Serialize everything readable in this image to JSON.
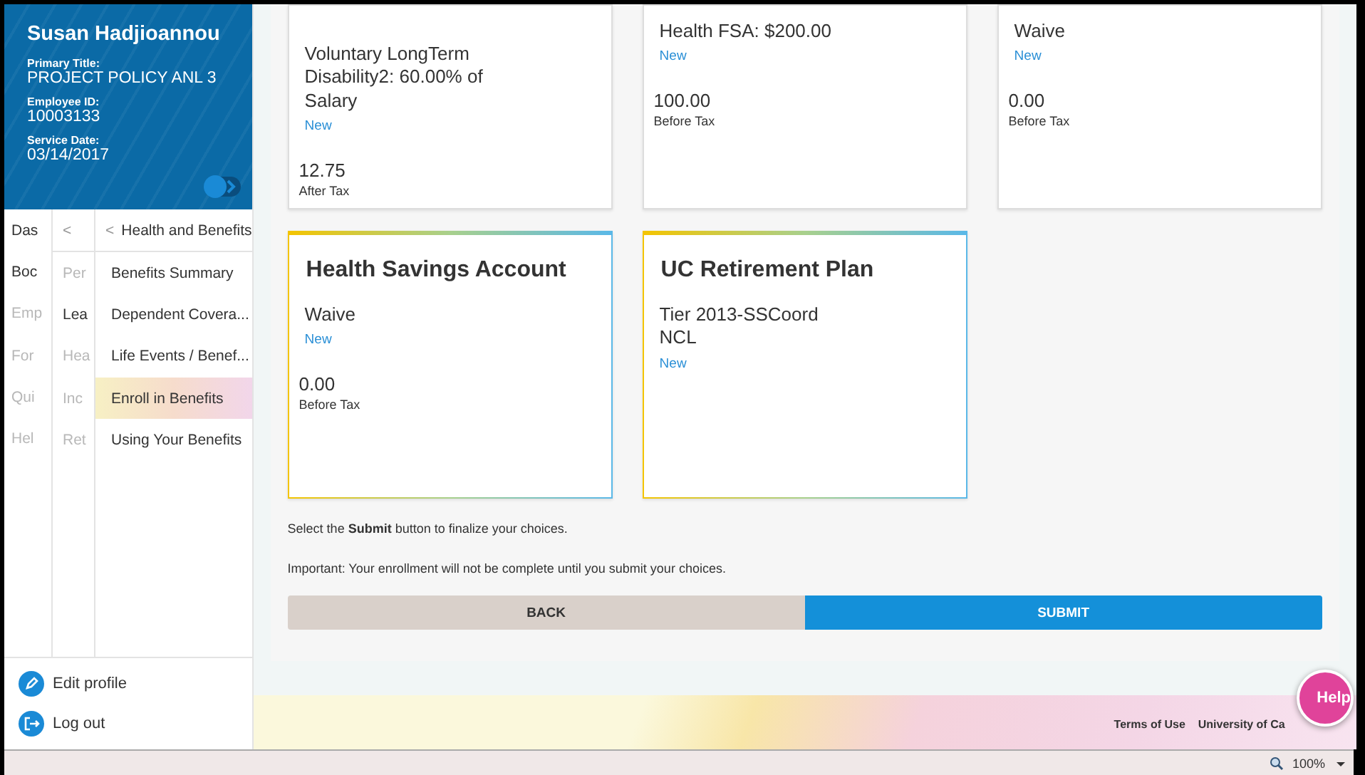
{
  "profile": {
    "name": "Susan Hadjioannou",
    "fields": [
      {
        "label": "Primary Title:",
        "value": "PROJECT POLICY ANL 3"
      },
      {
        "label": "Employee ID:",
        "value": "10003133"
      },
      {
        "label": "Service Date:",
        "value": "03/14/2017"
      }
    ]
  },
  "nav_column_1": [
    {
      "label": "Das",
      "disabled": false
    },
    {
      "label": "Boc",
      "disabled": false
    },
    {
      "label": "Emp",
      "disabled": true
    },
    {
      "label": "For",
      "disabled": true
    },
    {
      "label": "Qui",
      "disabled": true
    },
    {
      "label": "Hel",
      "disabled": true
    }
  ],
  "nav_column_2": {
    "back": "<",
    "items": [
      {
        "label": "Per",
        "disabled": true
      },
      {
        "label": "Lea",
        "disabled": false
      },
      {
        "label": "Hea",
        "disabled": true
      },
      {
        "label": "Inc",
        "disabled": true
      },
      {
        "label": "Ret",
        "disabled": true
      }
    ]
  },
  "nav_column_3": {
    "back": "<",
    "title": "Health and Benefits",
    "items": [
      {
        "label": "Benefits Summary",
        "selected": false
      },
      {
        "label": "Dependent Covera...",
        "selected": false
      },
      {
        "label": "Life Events / Benef...",
        "selected": false
      },
      {
        "label": "Enroll in Benefits",
        "selected": true
      },
      {
        "label": "Using Your Benefits",
        "selected": false
      }
    ]
  },
  "sidebar_footer": [
    {
      "kind": "edit",
      "label": "Edit profile"
    },
    {
      "kind": "logout",
      "label": "Log out"
    }
  ],
  "cards": [
    {
      "plan": "Voluntary LongTerm Disability2: 60.00% of Salary",
      "status": "New",
      "amount": "12.75",
      "tax": "After Tax"
    },
    {
      "plan": "Health FSA: $200.00",
      "status": "New",
      "amount": "100.00",
      "tax": "Before Tax"
    },
    {
      "plan": "Waive",
      "status": "New",
      "amount": "0.00",
      "tax": "Before Tax"
    },
    {
      "title": "Health Savings Account",
      "plan": "Waive",
      "status": "New",
      "amount": "0.00",
      "tax": "Before Tax"
    },
    {
      "title": "UC Retirement Plan",
      "plan": "Tier 2013-SSCoord NCL",
      "status": "New"
    }
  ],
  "instructions": [
    "Select the **Submit** button to finalize your choices.",
    "Important: Your enrollment will not be complete until you submit your choices."
  ],
  "buttons": [
    {
      "kind": "secondary",
      "label": "BACK"
    },
    {
      "kind": "primary",
      "label": "SUBMIT"
    }
  ],
  "footer_links": [
    "Terms of Use",
    "University of Ca"
  ],
  "help_button": "Help",
  "status_bar": {
    "zoom": "100%"
  }
}
